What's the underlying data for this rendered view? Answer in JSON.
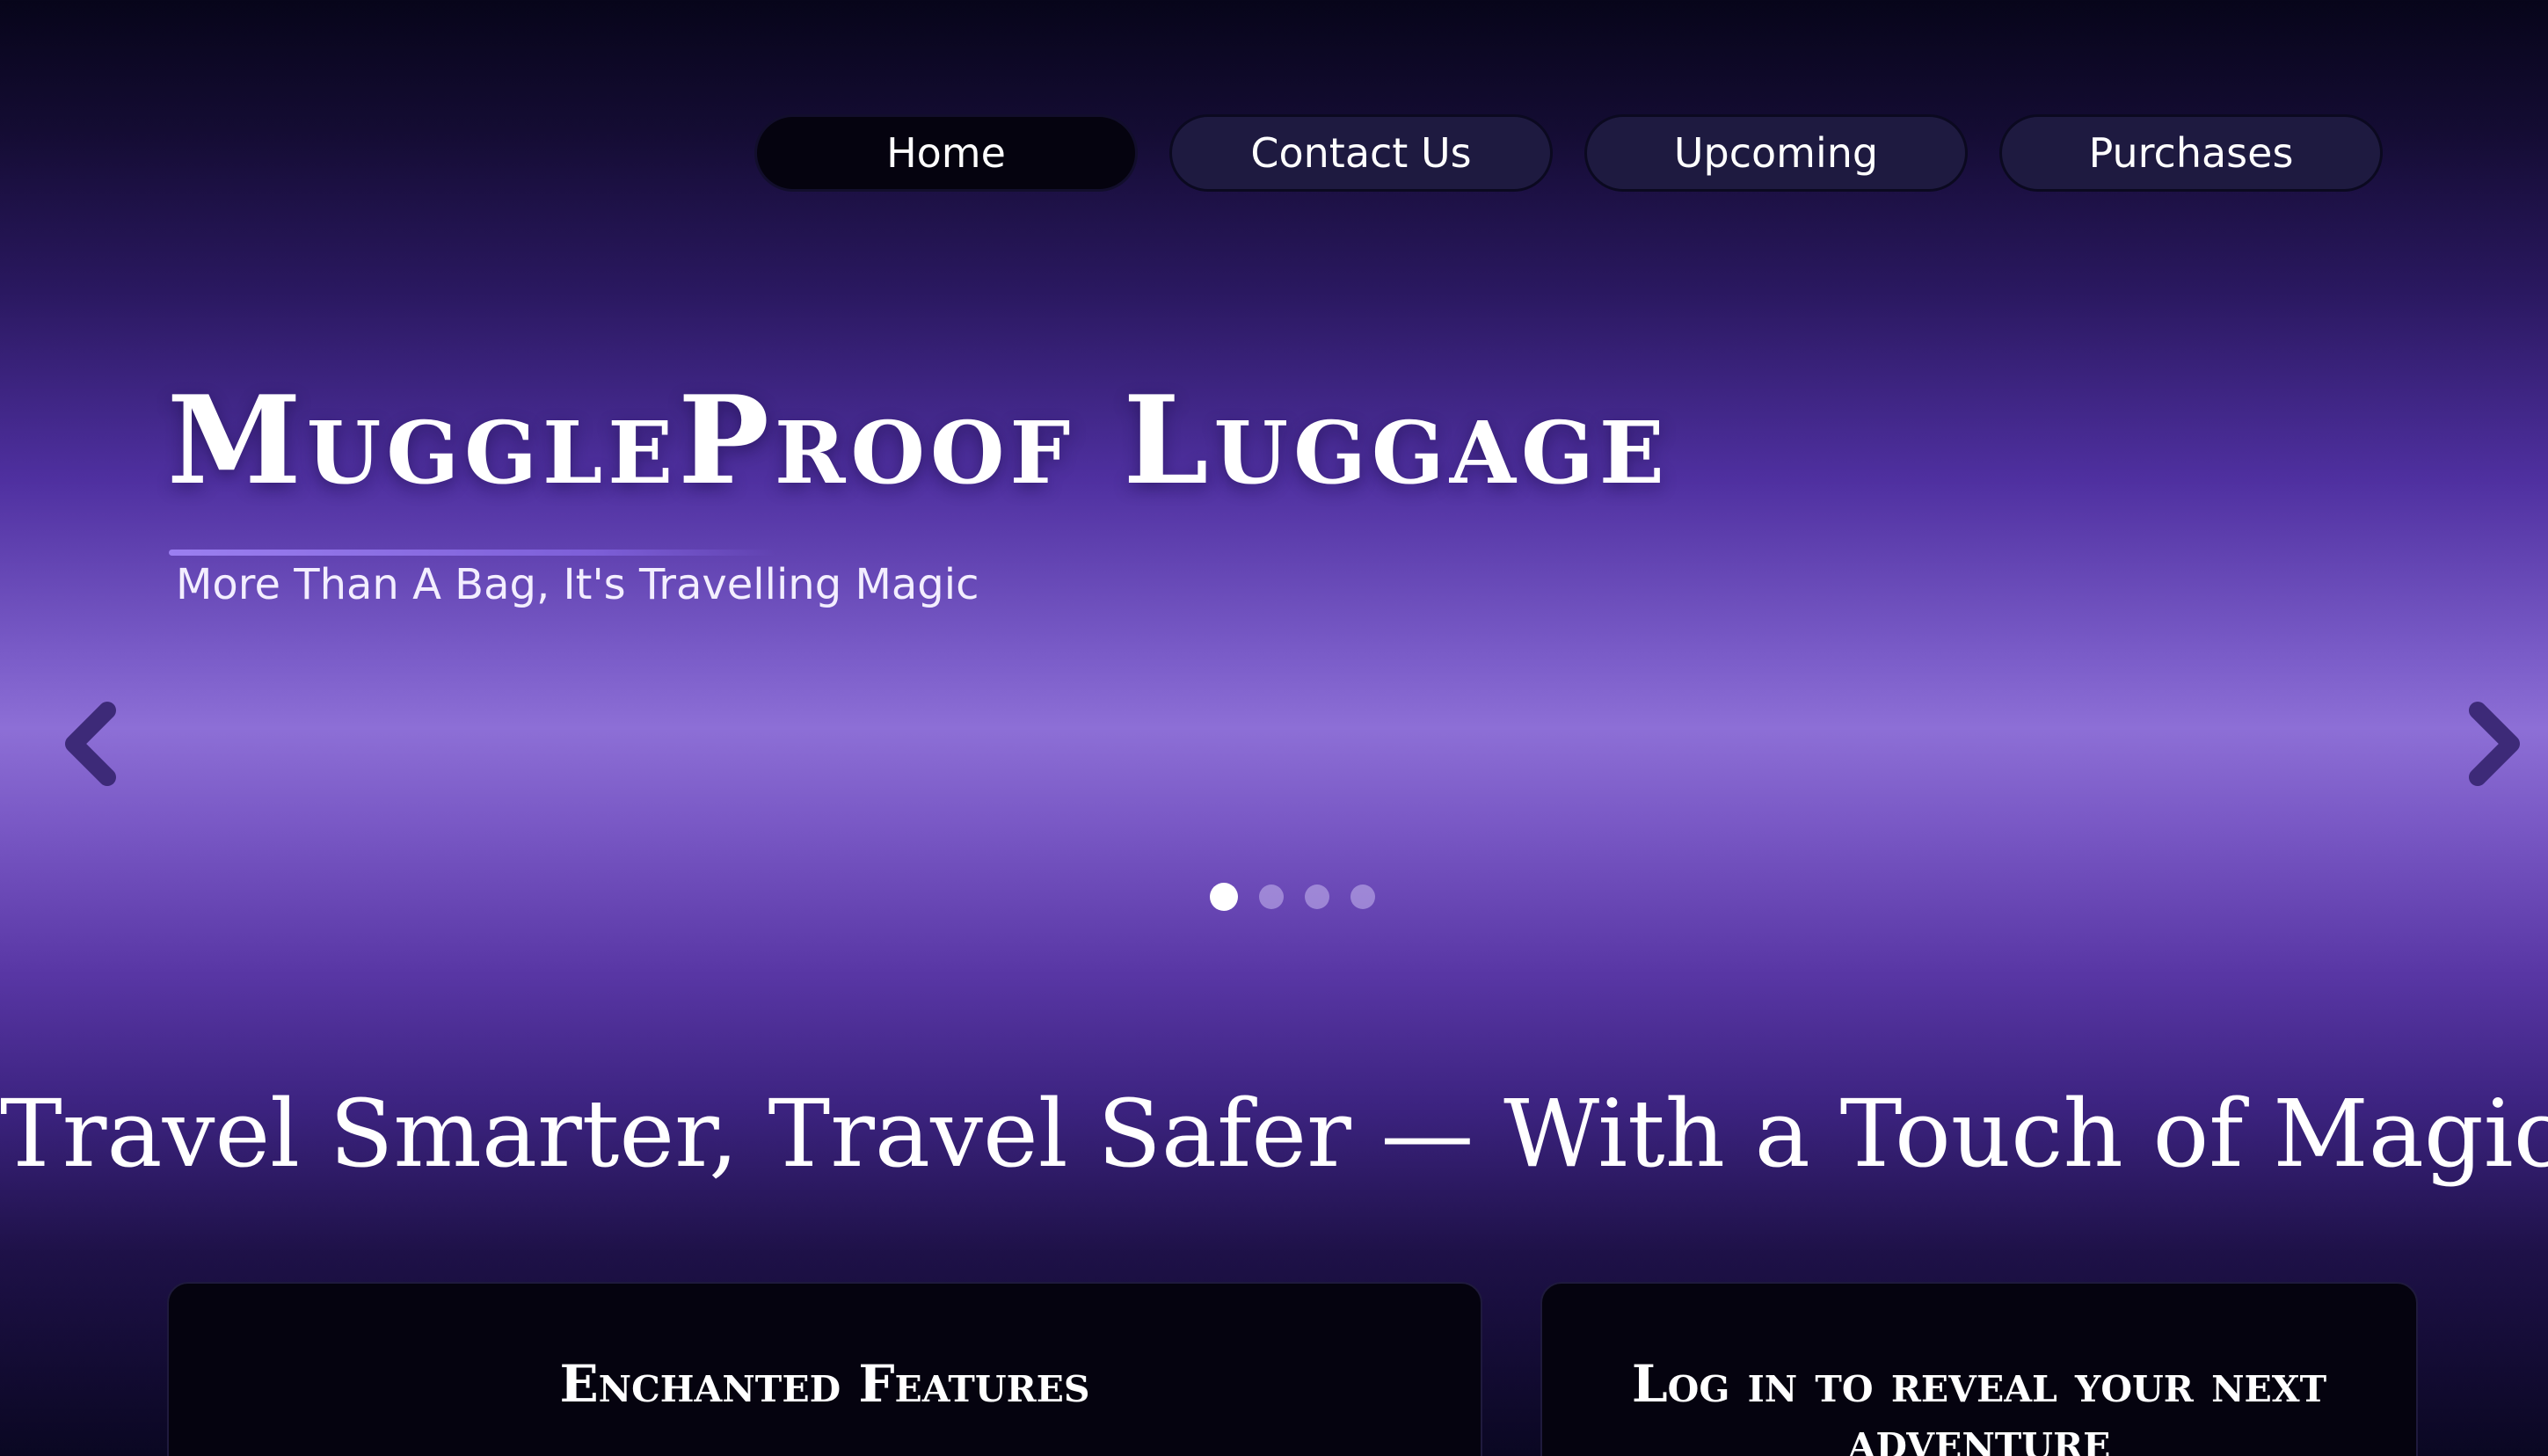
{
  "nav": {
    "items": [
      {
        "label": "Home",
        "active": true
      },
      {
        "label": "Contact Us",
        "active": false
      },
      {
        "label": "Upcoming",
        "active": false
      },
      {
        "label": "Purchases",
        "active": false
      }
    ]
  },
  "hero": {
    "title": "MuggleProof Luggage",
    "subtitle": "More Than A Bag, It's Travelling Magic"
  },
  "carousel": {
    "prev_icon": "chevron-left-icon",
    "next_icon": "chevron-right-icon",
    "slide_count": 4,
    "active_slide": 1
  },
  "tagline": "Travel Smarter, Travel Safer — With a Touch of Magic",
  "cards": {
    "features_title": "Enchanted Features",
    "login_title": "Log in to reveal your next adventure"
  },
  "colors": {
    "nav_button_bg": "#1e1a40",
    "nav_button_active_bg": "#05030f",
    "accent": "#8d6fd6",
    "card_bg": "#05030f"
  }
}
